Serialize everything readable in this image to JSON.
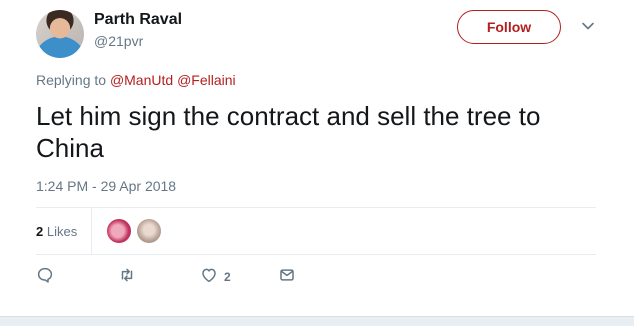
{
  "author": {
    "name": "Parth Raval",
    "handle": "@21pvr"
  },
  "follow_label": "Follow",
  "reply": {
    "prefix": "Replying to",
    "mentions": [
      "@ManUtd",
      "@Fellaini"
    ]
  },
  "tweet": {
    "text": "Let him sign the contract and sell the tree to China",
    "timestamp": "1:24 PM - 29 Apr 2018"
  },
  "stats": {
    "likes_count": "2",
    "likes_label": "Likes"
  },
  "actions": {
    "like_count": "2"
  },
  "colors": {
    "accent": "#b31f1f",
    "muted": "#657786"
  },
  "icons": [
    "chevron-down-icon",
    "reply-icon",
    "retweet-icon",
    "heart-icon",
    "message-icon"
  ]
}
